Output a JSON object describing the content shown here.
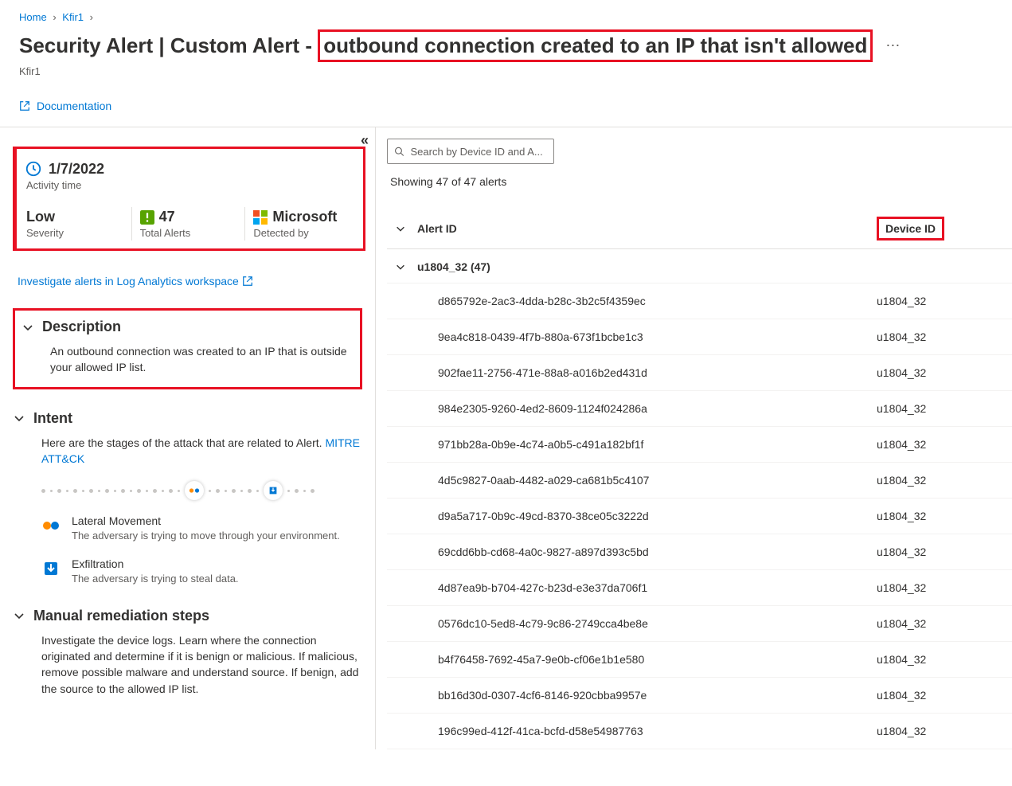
{
  "breadcrumb": {
    "home": "Home",
    "item1": "Kfir1"
  },
  "page_title_prefix": "Security Alert | Custom Alert - ",
  "page_title_highlight": "outbound connection created to an IP that isn't allowed",
  "subtitle": "Kfir1",
  "documentation_link": "Documentation",
  "summary": {
    "activity_date": "1/7/2022",
    "activity_label": "Activity time",
    "severity_value": "Low",
    "severity_label": "Severity",
    "total_alerts_value": "47",
    "total_alerts_label": "Total Alerts",
    "detected_by_value": "Microsoft",
    "detected_by_label": "Detected by"
  },
  "investigate_link": "Investigate alerts in Log Analytics workspace",
  "description": {
    "title": "Description",
    "body": "An outbound connection was created to an IP that is outside your allowed IP list."
  },
  "intent": {
    "title": "Intent",
    "body": "Here are the stages of the attack that are related to Alert. ",
    "mitre": "MITRE ATT&CK",
    "tactics": [
      {
        "name": "Lateral Movement",
        "desc": "The adversary is trying to move through your environment."
      },
      {
        "name": "Exfiltration",
        "desc": "The adversary is trying to steal data."
      }
    ]
  },
  "remediation": {
    "title": "Manual remediation steps",
    "body": "Investigate the device logs. Learn where the connection originated and determine if it is benign or malicious. If malicious, remove possible malware and understand source. If benign, add the source to the allowed IP list."
  },
  "right": {
    "search_placeholder": "Search by Device ID and A...",
    "showing": "Showing 47 of 47 alerts",
    "columns": {
      "alert_id": "Alert ID",
      "device_id": "Device ID"
    },
    "group_name": "u1804_32 (47)",
    "rows": [
      {
        "alert_id": "d865792e-2ac3-4dda-b28c-3b2c5f4359ec",
        "device_id": "u1804_32"
      },
      {
        "alert_id": "9ea4c818-0439-4f7b-880a-673f1bcbe1c3",
        "device_id": "u1804_32"
      },
      {
        "alert_id": "902fae11-2756-471e-88a8-a016b2ed431d",
        "device_id": "u1804_32"
      },
      {
        "alert_id": "984e2305-9260-4ed2-8609-1124f024286a",
        "device_id": "u1804_32"
      },
      {
        "alert_id": "971bb28a-0b9e-4c74-a0b5-c491a182bf1f",
        "device_id": "u1804_32"
      },
      {
        "alert_id": "4d5c9827-0aab-4482-a029-ca681b5c4107",
        "device_id": "u1804_32"
      },
      {
        "alert_id": "d9a5a717-0b9c-49cd-8370-38ce05c3222d",
        "device_id": "u1804_32"
      },
      {
        "alert_id": "69cdd6bb-cd68-4a0c-9827-a897d393c5bd",
        "device_id": "u1804_32"
      },
      {
        "alert_id": "4d87ea9b-b704-427c-b23d-e3e37da706f1",
        "device_id": "u1804_32"
      },
      {
        "alert_id": "0576dc10-5ed8-4c79-9c86-2749cca4be8e",
        "device_id": "u1804_32"
      },
      {
        "alert_id": "b4f76458-7692-45a7-9e0b-cf06e1b1e580",
        "device_id": "u1804_32"
      },
      {
        "alert_id": "bb16d30d-0307-4cf6-8146-920cbba9957e",
        "device_id": "u1804_32"
      },
      {
        "alert_id": "196c99ed-412f-41ca-bcfd-d58e54987763",
        "device_id": "u1804_32"
      }
    ]
  }
}
